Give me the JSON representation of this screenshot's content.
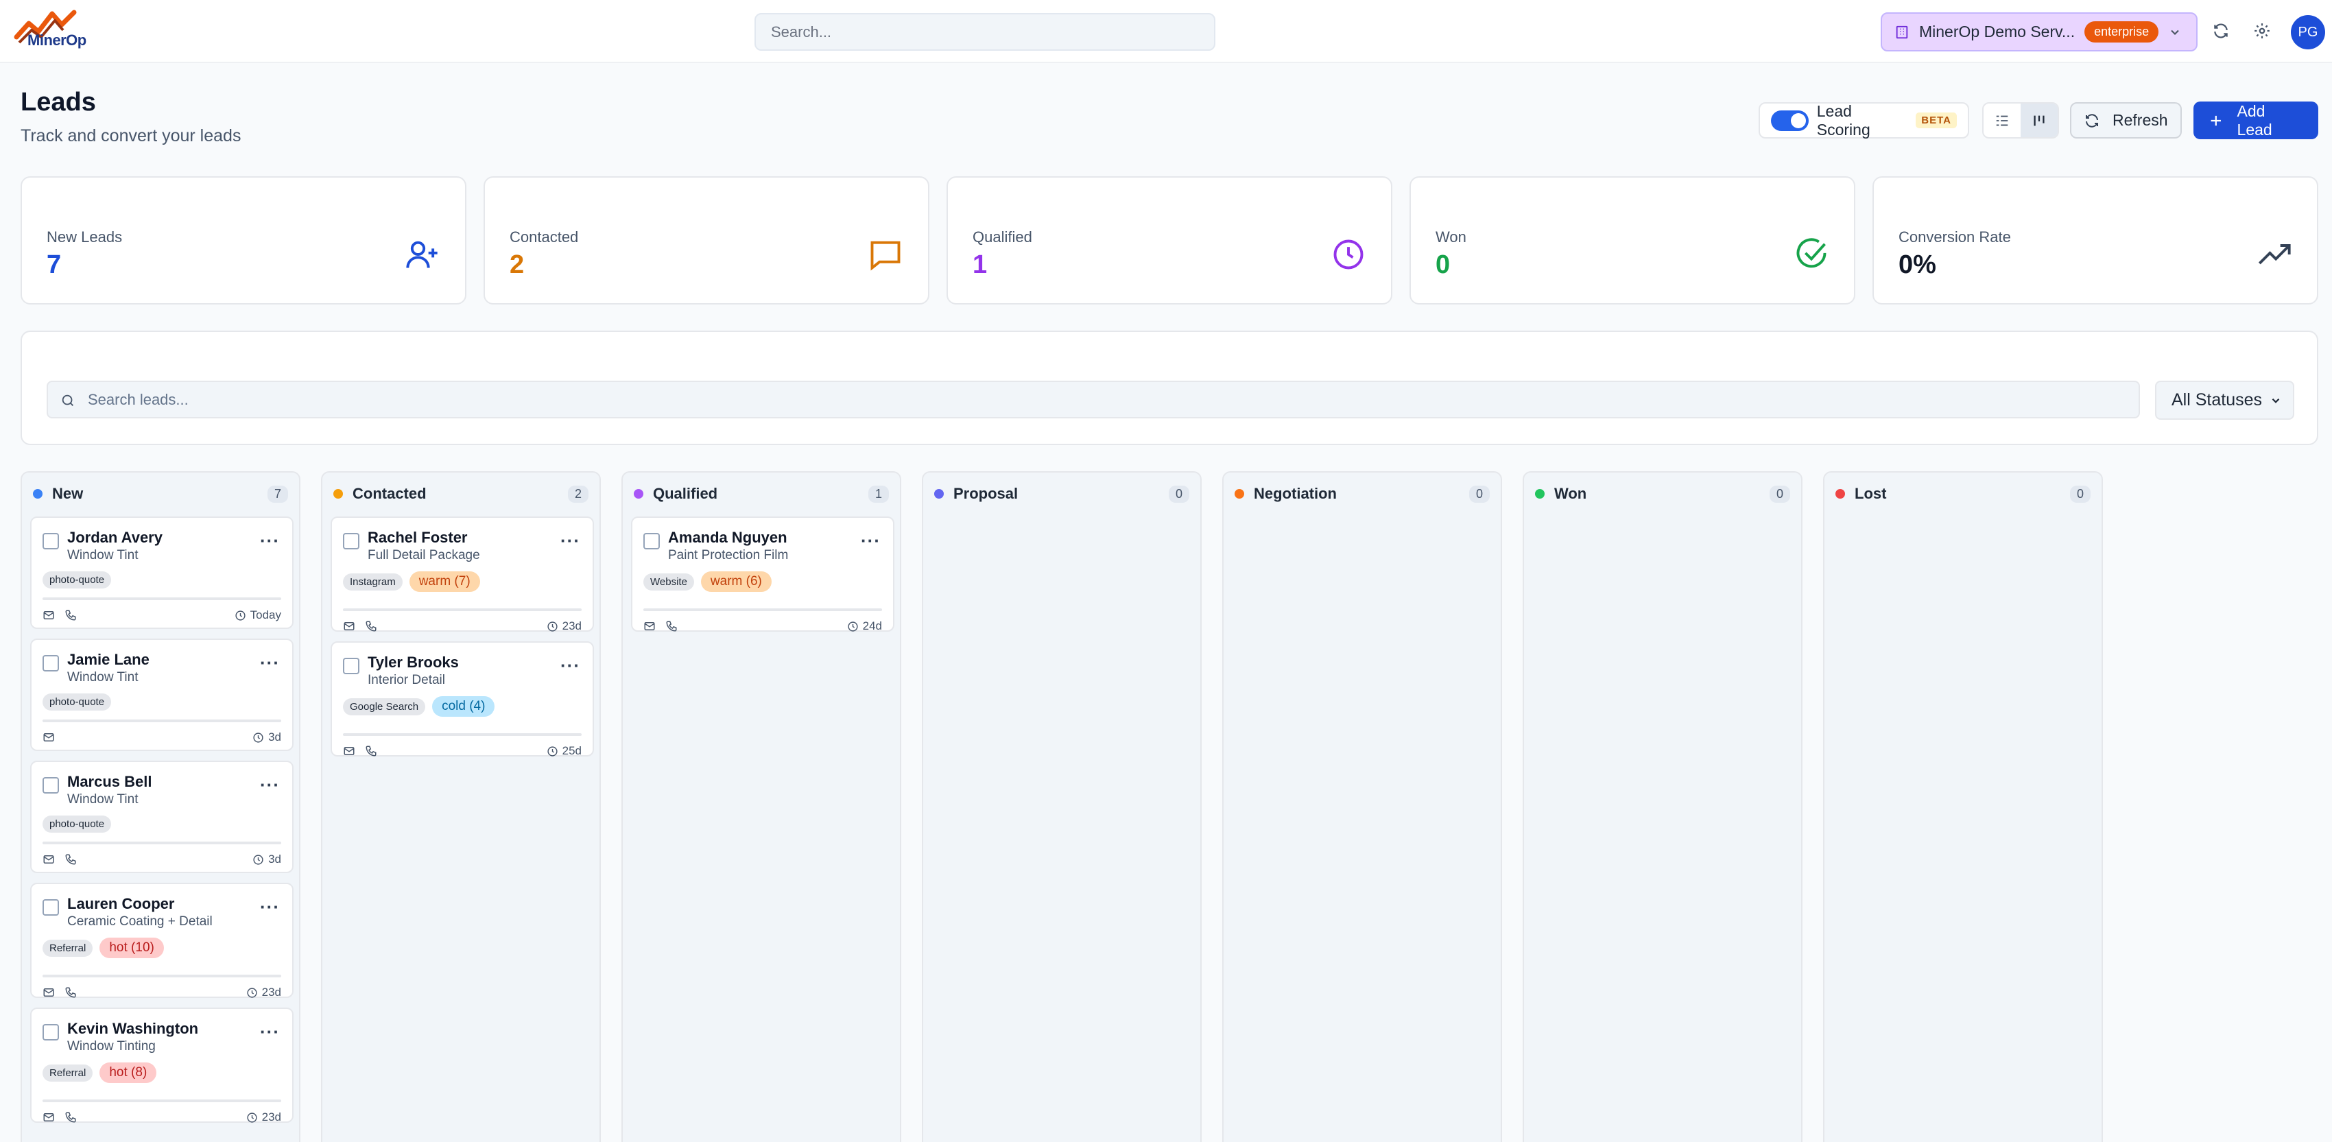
{
  "app": {
    "logo_text": "MinerOp"
  },
  "topbar": {
    "search_placeholder": "Search...",
    "org_name": "MinerOp Demo Serv...",
    "plan_badge": "enterprise",
    "avatar_initials": "PG"
  },
  "header": {
    "title": "Leads",
    "subtitle": "Track and convert your leads",
    "lead_scoring_label": "Lead Scoring",
    "lead_scoring_badge": "BETA",
    "lead_scoring_enabled": true,
    "refresh_label": "Refresh",
    "add_lead_label": "Add Lead"
  },
  "stats": [
    {
      "label": "New Leads",
      "value": "7",
      "color": "#1d4ed8",
      "icon": "user-plus-icon"
    },
    {
      "label": "Contacted",
      "value": "2",
      "color": "#d97706",
      "icon": "message-icon"
    },
    {
      "label": "Qualified",
      "value": "1",
      "color": "#9333ea",
      "icon": "clock-icon"
    },
    {
      "label": "Won",
      "value": "0",
      "color": "#16a34a",
      "icon": "check-circle-icon"
    },
    {
      "label": "Conversion Rate",
      "value": "0%",
      "color": "#111827",
      "icon": "trending-up-icon"
    }
  ],
  "filters": {
    "search_placeholder": "Search leads...",
    "status_selected": "All Statuses"
  },
  "columns": [
    {
      "title": "New",
      "count": "7",
      "color": "#3b82f6",
      "cards": [
        {
          "name": "Jordan Avery",
          "service": "Window Tint",
          "tags": [
            "photo-quote"
          ],
          "score": null,
          "phone": true,
          "age": "Today"
        },
        {
          "name": "Jamie Lane",
          "service": "Window Tint",
          "tags": [
            "photo-quote"
          ],
          "score": null,
          "phone": false,
          "age": "3d"
        },
        {
          "name": "Marcus Bell",
          "service": "Window Tint",
          "tags": [
            "photo-quote"
          ],
          "score": null,
          "phone": true,
          "age": "3d"
        },
        {
          "name": "Lauren Cooper",
          "service": "Ceramic Coating + Detail",
          "tags": [
            "Referral"
          ],
          "score": {
            "text": "hot (10)",
            "kind": "hot"
          },
          "phone": true,
          "age": "23d"
        },
        {
          "name": "Kevin Washington",
          "service": "Window Tinting",
          "tags": [
            "Referral"
          ],
          "score": {
            "text": "hot (8)",
            "kind": "hot"
          },
          "phone": true,
          "age": "23d"
        }
      ]
    },
    {
      "title": "Contacted",
      "count": "2",
      "color": "#f59e0b",
      "cards": [
        {
          "name": "Rachel Foster",
          "service": "Full Detail Package",
          "tags": [
            "Instagram"
          ],
          "score": {
            "text": "warm (7)",
            "kind": "warm"
          },
          "phone": true,
          "age": "23d"
        },
        {
          "name": "Tyler Brooks",
          "service": "Interior Detail",
          "tags": [
            "Google Search"
          ],
          "score": {
            "text": "cold (4)",
            "kind": "cold"
          },
          "phone": true,
          "age": "25d"
        }
      ]
    },
    {
      "title": "Qualified",
      "count": "1",
      "color": "#a855f7",
      "cards": [
        {
          "name": "Amanda Nguyen",
          "service": "Paint Protection Film",
          "tags": [
            "Website"
          ],
          "score": {
            "text": "warm (6)",
            "kind": "warm"
          },
          "phone": true,
          "age": "24d"
        }
      ]
    },
    {
      "title": "Proposal",
      "count": "0",
      "color": "#6366f1",
      "cards": []
    },
    {
      "title": "Negotiation",
      "count": "0",
      "color": "#f97316",
      "cards": []
    },
    {
      "title": "Won",
      "count": "0",
      "color": "#22c55e",
      "cards": []
    },
    {
      "title": "Lost",
      "count": "0",
      "color": "#ef4444",
      "cards": []
    }
  ]
}
